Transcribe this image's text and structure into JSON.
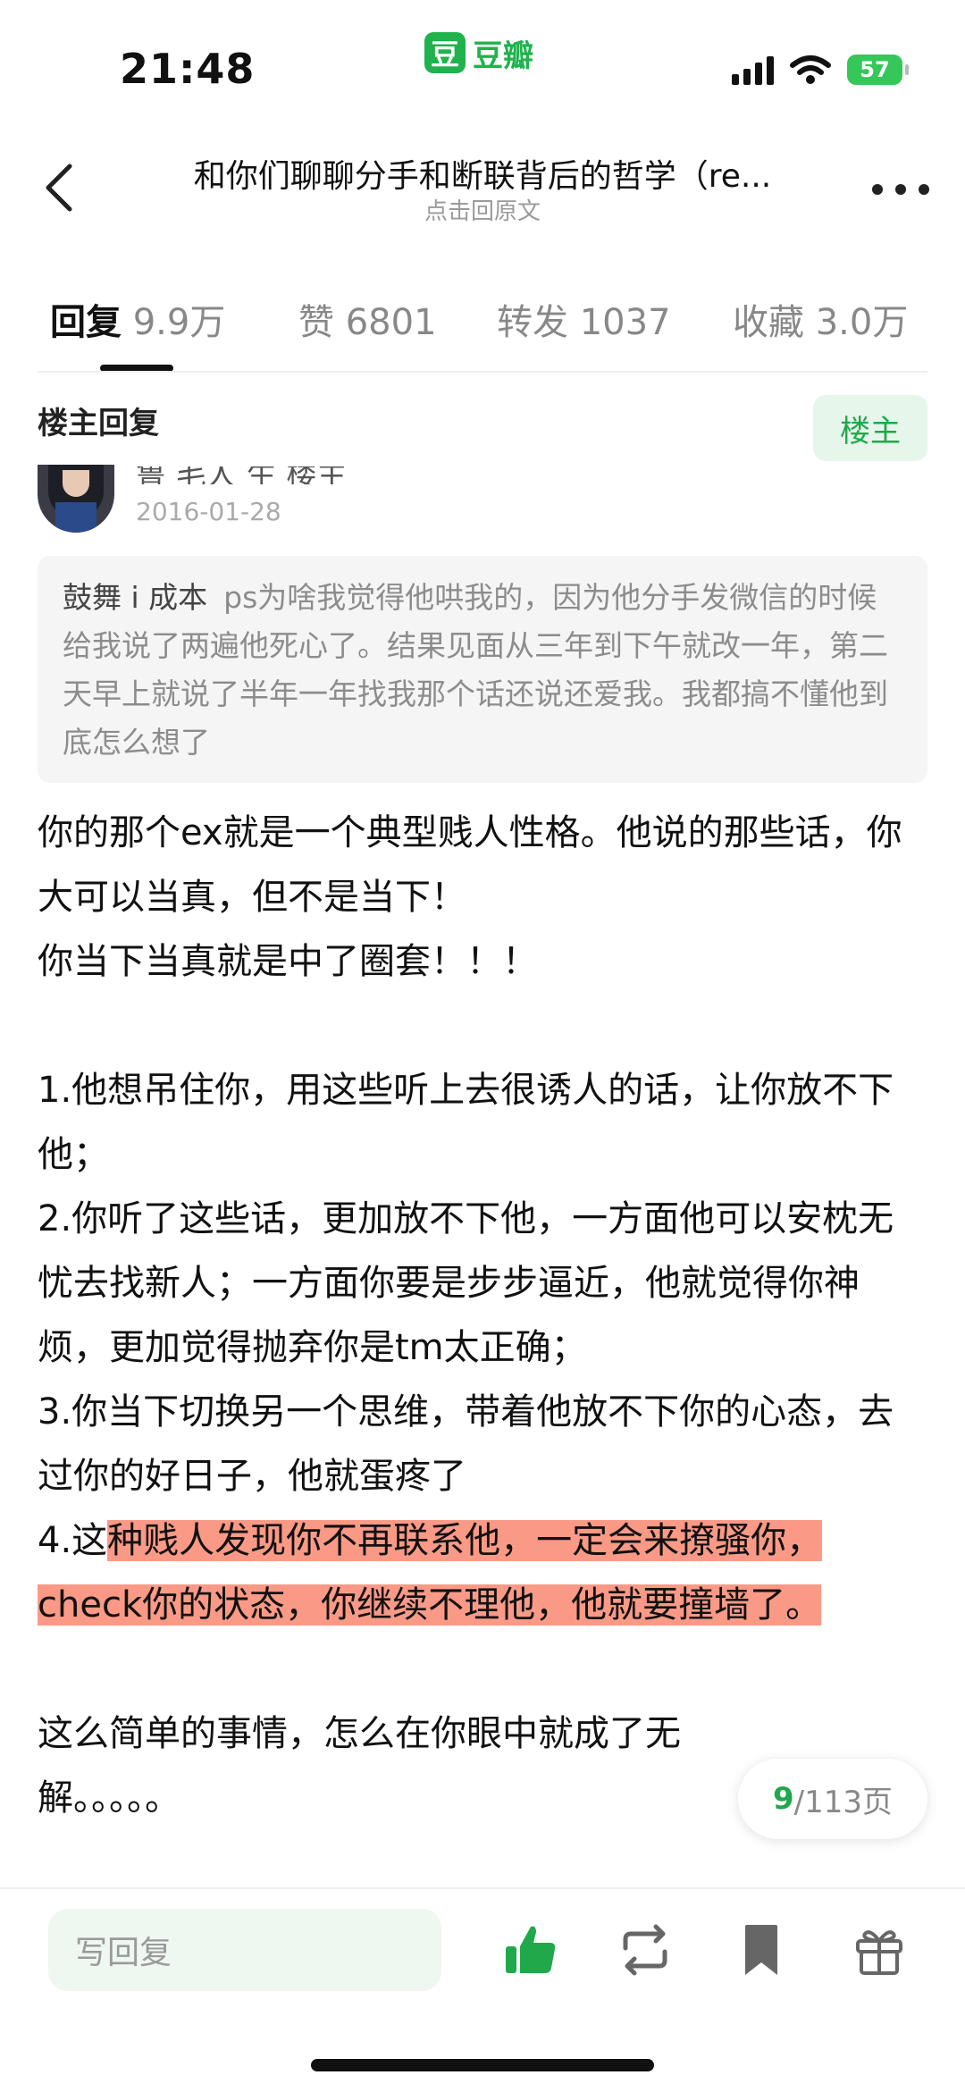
{
  "status_bar": {
    "time": "21:48",
    "app_logo_glyph": "豆",
    "app_name": "豆瓣",
    "battery": "57",
    "icons": [
      "signal-icon",
      "wifi-icon",
      "battery-icon"
    ]
  },
  "nav": {
    "title": "和你们聊聊分手和断联背后的哲学（re...",
    "subtitle": "点击回原文",
    "icons": [
      "back-icon",
      "more-icon"
    ]
  },
  "tabs": [
    {
      "label": "回复",
      "count": "9.9万",
      "active": true
    },
    {
      "label": "赞",
      "count": "6801",
      "active": false
    },
    {
      "label": "转发",
      "count": "1037",
      "active": false
    },
    {
      "label": "收藏",
      "count": "3.0万",
      "active": false
    }
  ],
  "section": {
    "title": "楼主回复",
    "op_button": "楼主"
  },
  "author": {
    "name_partial": "鲁 毛人 生 楼主",
    "date": "2016-01-28"
  },
  "quote": {
    "author": "鼓舞 i 成本",
    "text": "ps为啥我觉得他哄我的，因为他分手发微信的时候给我说了两遍他死心了。结果见面从三年到下午就改一年，第二天早上就说了半年一年找我那个话还说还爱我。我都搞不懂他到底怎么想了"
  },
  "reply": {
    "line1": "你的那个ex就是一个典型贱人性格。他说的那些话，你大可以当真，但不是当下！",
    "line2": "你当下当真就是中了圈套！！！",
    "item1": "1.他想吊住你，用这些听上去很诱人的话，让你放不下他；",
    "item2": "2.你听了这些话，更加放不下他，一方面他可以安枕无忧去找新人；一方面你要是步步逼近，他就觉得你神烦，更加觉得抛弃你是tm太正确；",
    "item3": "3.你当下切换另一个思维，带着他放不下你的心态，去过你的好日子，他就蛋疼了",
    "item4_prefix": "4.这",
    "item4_highlight": "种贱人发现你不再联系他，一定会来撩骚你，check你的状态，你继续不理他，他就要撞墙了。",
    "closing": "这么简单的事情，怎么在你眼中就成了无解。。。。。"
  },
  "page_indicator": {
    "current": "9",
    "total": "/113页"
  },
  "bottom_bar": {
    "reply_placeholder": "写回复",
    "icons": [
      "like-icon",
      "repost-icon",
      "bookmark-icon",
      "gift-icon"
    ]
  },
  "colors": {
    "accent": "#20a84a",
    "douban_green": "#20b24d",
    "highlight": "#fa9a86",
    "battery": "#35c759"
  }
}
